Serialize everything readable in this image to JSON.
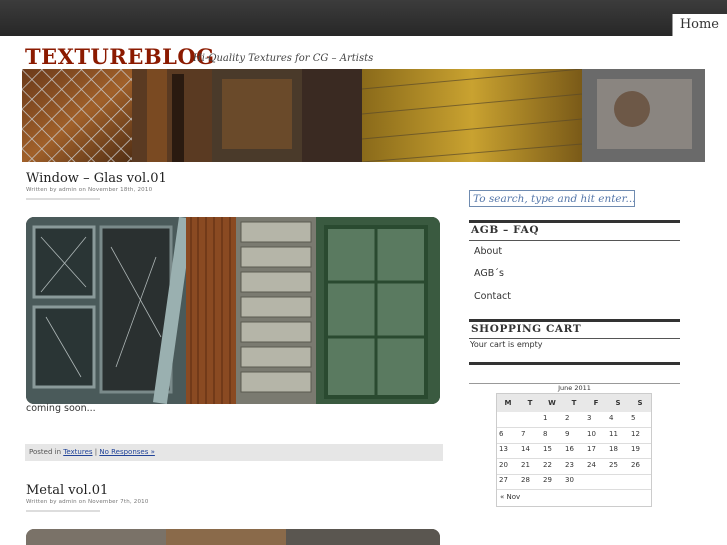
{
  "nav": {
    "home_label": "Home"
  },
  "brand": {
    "name": "TEXTUREBLOG",
    "tagline": "Hi-Quality Textures for CG – Artists"
  },
  "posts": [
    {
      "title": "Window – Glas vol.01",
      "meta": "Written by admin on November 18th, 2010",
      "body": "coming soon...",
      "footer_prefix": "Posted in",
      "category": "Textures",
      "separator": "|",
      "responses": "No Responses »"
    },
    {
      "title": "Metal vol.01",
      "meta": "Written by admin on November 7th, 2010"
    }
  ],
  "sidebar": {
    "search_placeholder": "To search, type and hit enter...",
    "faq_heading": "AGB – FAQ",
    "links": [
      "About",
      "AGB´s",
      "Contact"
    ],
    "cart_heading": "SHOPPING CART",
    "cart_text": "Your cart is empty"
  },
  "calendar": {
    "caption": "June 2011",
    "weekdays": [
      "M",
      "T",
      "W",
      "T",
      "F",
      "S",
      "S"
    ],
    "weeks": [
      [
        "",
        "",
        "1",
        "2",
        "3",
        "4",
        "5"
      ],
      [
        "6",
        "7",
        "8",
        "9",
        "10",
        "11",
        "12"
      ],
      [
        "13",
        "14",
        "15",
        "16",
        "17",
        "18",
        "19"
      ],
      [
        "20",
        "21",
        "22",
        "23",
        "24",
        "25",
        "26"
      ],
      [
        "27",
        "28",
        "29",
        "30",
        "",
        "",
        ""
      ]
    ],
    "prev_link": "« Nov"
  },
  "colors": {
    "brand": "#8b1a00",
    "link": "#224499",
    "topbar": "#2e2e2e"
  }
}
